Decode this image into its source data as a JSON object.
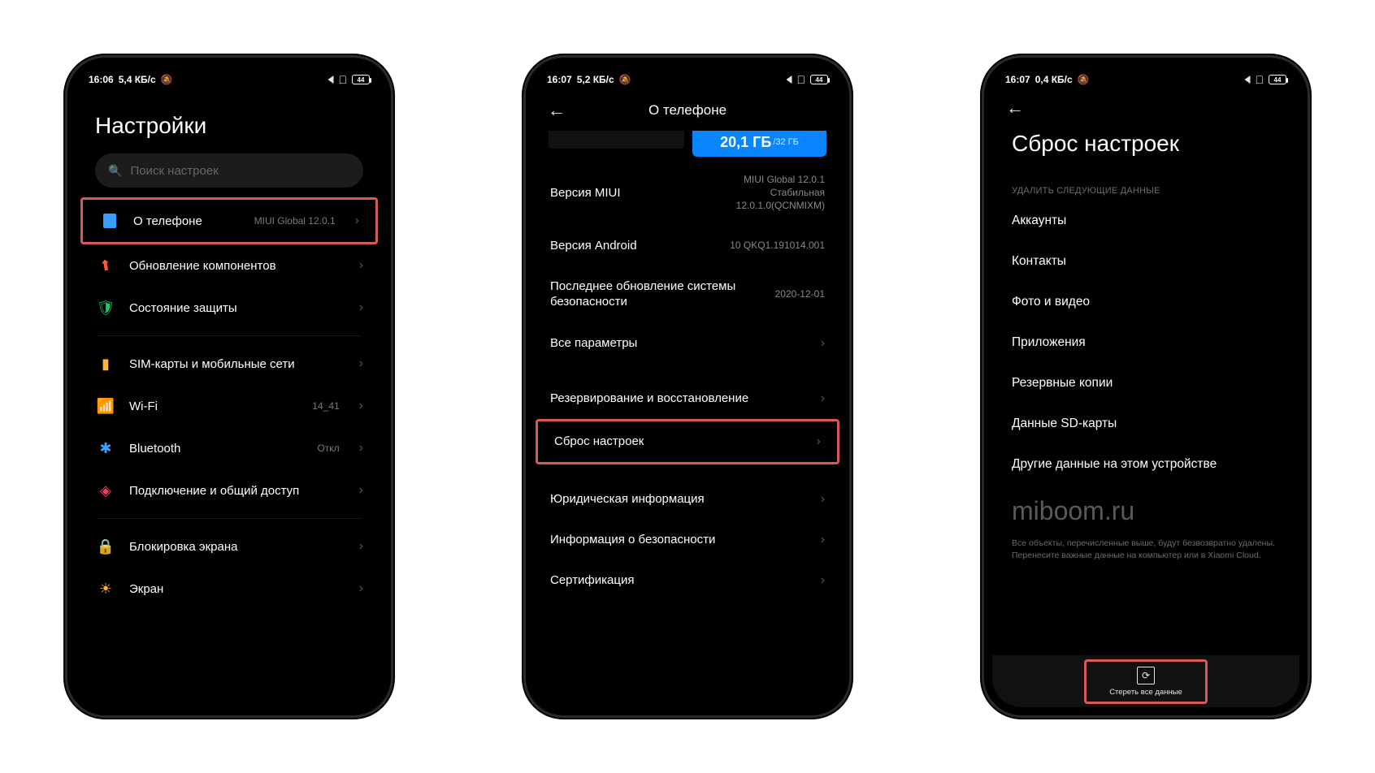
{
  "phone1": {
    "status": {
      "time": "16:06",
      "speed": "5,4 КБ/с",
      "batt": "44"
    },
    "title": "Настройки",
    "search_placeholder": "Поиск настроек",
    "rows": [
      {
        "label": "О телефоне",
        "value": "MIUI Global 12.0.1",
        "highlight": true
      },
      {
        "label": "Обновление компонентов"
      },
      {
        "label": "Состояние защиты"
      }
    ],
    "rows2": [
      {
        "label": "SIM-карты и мобильные сети"
      },
      {
        "label": "Wi-Fi",
        "value": "14_41"
      },
      {
        "label": "Bluetooth",
        "value": "Откл"
      },
      {
        "label": "Подключение и общий доступ"
      }
    ],
    "rows3": [
      {
        "label": "Блокировка экрана"
      },
      {
        "label": "Экран"
      }
    ]
  },
  "phone2": {
    "status": {
      "time": "16:07",
      "speed": "5,2 КБ/с",
      "batt": "44"
    },
    "header": "О телефоне",
    "storage_value": "20,1 ГБ",
    "storage_total": "/32 ГБ",
    "rows": [
      {
        "label": "Версия MIUI",
        "value": "MIUI Global 12.0.1\nСтабильная\n12.0.1.0(QCNMIXM)"
      },
      {
        "label": "Версия Android",
        "value": "10 QKQ1.191014.001"
      },
      {
        "label": "Последнее обновление системы безопасности",
        "value": "2020-12-01",
        "multi": true
      },
      {
        "label": "Все параметры",
        "chev": true
      }
    ],
    "rows2": [
      {
        "label": "Резервирование и восстановление",
        "chev": true
      },
      {
        "label": "Сброс настроек",
        "chev": true,
        "highlight": true
      }
    ],
    "rows3": [
      {
        "label": "Юридическая информация",
        "chev": true
      },
      {
        "label": "Информация о безопасности",
        "chev": true
      },
      {
        "label": "Сертификация",
        "chev": true
      }
    ]
  },
  "phone3": {
    "status": {
      "time": "16:07",
      "speed": "0,4 КБ/с",
      "batt": "44"
    },
    "title": "Сброс настроек",
    "section_hint": "УДАЛИТЬ СЛЕДУЮЩИЕ ДАННЫЕ",
    "items": [
      "Аккаунты",
      "Контакты",
      "Фото и видео",
      "Приложения",
      "Резервные копии",
      "Данные SD-карты",
      "Другие данные на этом устройстве"
    ],
    "watermark": "miboom.ru",
    "fine_print": "Все объекты, перечисленные выше, будут безвозвратно удалены. Перенесите важные данные на компьютер или в Xiaomi Cloud.",
    "erase_label": "Стереть все данные"
  }
}
